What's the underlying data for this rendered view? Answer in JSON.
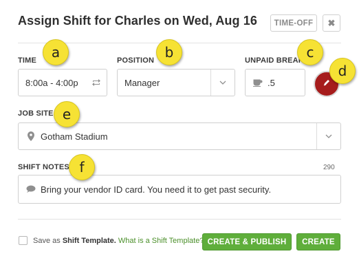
{
  "dialog": {
    "title": "Assign Shift for Charles on Wed, Aug 16",
    "time_off_label": "TIME-OFF",
    "close_label": "✖"
  },
  "time": {
    "label": "TIME",
    "value": "8:00a - 4:00p",
    "icon": "repeat-icon"
  },
  "position": {
    "label": "POSITION",
    "value": "Manager",
    "icon": "chevron-down-icon"
  },
  "unpaid_break": {
    "label": "UNPAID BREAK",
    "value": ".5",
    "icon": "coffee-cup-icon"
  },
  "color_picker": {
    "icon": "pencil-icon",
    "color": "#a61c1c"
  },
  "job_site": {
    "label": "JOB SITE",
    "value": "Gotham Stadium",
    "icon": "map-pin-icon"
  },
  "shift_notes": {
    "label": "SHIFT NOTES",
    "remaining": "290",
    "value": "Bring your vendor ID card. You need it to get past security.",
    "icon": "speech-bubble-icon"
  },
  "callouts": [
    "a",
    "b",
    "c",
    "d",
    "e",
    "f"
  ],
  "footer": {
    "save_prefix": "Save as ",
    "template_label": "Shift Template.",
    "help_link": "What is a Shift Template?",
    "create_publish_label": "CREATE & PUBLISH",
    "create_label": "CREATE"
  },
  "colors": {
    "accent_green": "#5fae3b",
    "callout_yellow": "#f6e234"
  }
}
